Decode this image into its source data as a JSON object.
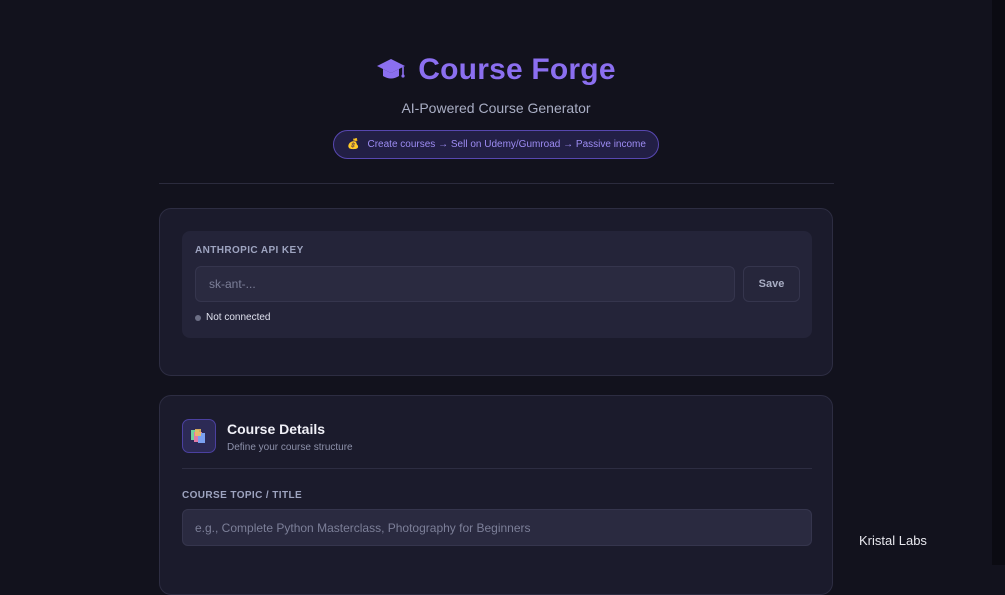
{
  "header": {
    "icon": "graduation-cap-icon",
    "title": "Course Forge",
    "subtitle": "AI-Powered Course Generator",
    "pill": {
      "icon": "money-bag-icon",
      "text": "Create courses → Sell on Udemy/Gumroad → Passive income"
    }
  },
  "api_card": {
    "label": "ANTHROPIC API KEY",
    "input": {
      "value": "",
      "placeholder": "sk-ant-..."
    },
    "save_label": "Save",
    "status_text": "Not connected"
  },
  "course_card": {
    "icon": "books-icon",
    "title": "Course Details",
    "subtitle": "Define your course structure",
    "topic_label": "COURSE TOPIC / TITLE",
    "topic_input": {
      "value": "",
      "placeholder": "e.g., Complete Python Masterclass, Photography for Beginners"
    }
  },
  "watermark": "Kristal Labs",
  "colors": {
    "background": "#12121d",
    "accent": "#8b6ff0",
    "card": "#1b1b2c",
    "status_dot": "#6c6f85"
  }
}
